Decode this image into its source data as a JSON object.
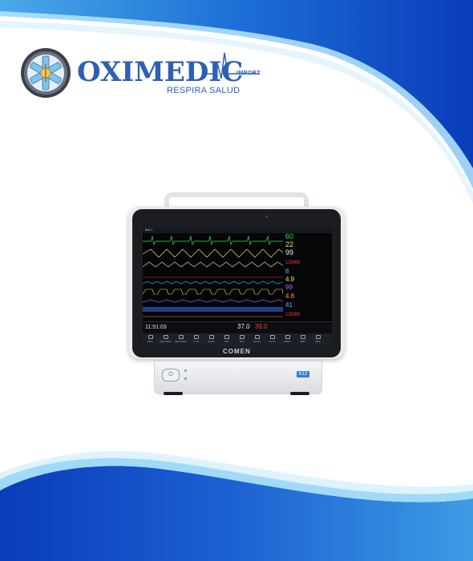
{
  "logo": {
    "wordmark": "OXIMEDIC",
    "import_label": "IMPORT",
    "tagline": "RESPIRA SALUD"
  },
  "colors": {
    "brand_blue": "#2e5fb6",
    "wave_dark_blue": "#0b3fb8",
    "wave_light_blue": "#6fc8f2",
    "screen_background": "#050608"
  },
  "monitor": {
    "brand": "COMEN",
    "model": "K12",
    "header_left": "Bed 1",
    "numerics": [
      {
        "label": "hr",
        "value": "60",
        "color": "#3ce04a"
      },
      {
        "label": "rr",
        "value": "22",
        "color": "#f3e84a"
      },
      {
        "label": "spo2",
        "value": "99",
        "color": "#f3f3f3"
      },
      {
        "label": "nibp",
        "value": "120/80",
        "color": "#ff3b3b"
      },
      {
        "label": "cvp",
        "value": "8",
        "color": "#5db1ff"
      },
      {
        "label": "etco2",
        "value": "4.9",
        "color": "#f3e84a"
      },
      {
        "label": "spo2b",
        "value": "99",
        "color": "#c760ff"
      },
      {
        "label": "co",
        "value": "4.8",
        "color": "#ff9d2d"
      },
      {
        "label": "pap",
        "value": "41",
        "color": "#5db1ff"
      },
      {
        "label": "art",
        "value": "120/80",
        "color": "#ff3b3b"
      }
    ],
    "bottom": {
      "time": "11:51:03",
      "temp1": "37.0",
      "temp2": "39.0"
    },
    "menu": [
      "Menu",
      "Alarm Setup",
      "Alarm Pause",
      "Trend",
      "Review",
      "Calc",
      "Drug",
      "Record",
      "Freeze",
      "Patient",
      "NIBP",
      "Setup"
    ]
  }
}
